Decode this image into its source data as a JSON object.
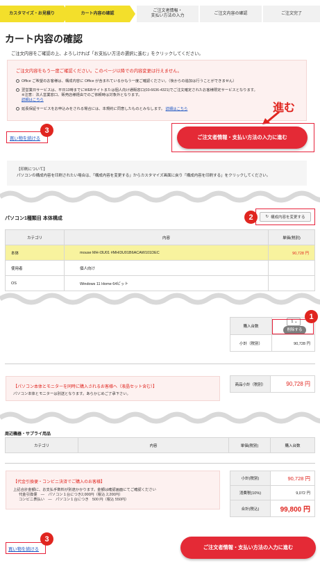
{
  "steps": [
    {
      "label": "カスタマイズ・お見積り",
      "state": "done"
    },
    {
      "label": "カート内容の確認",
      "state": "active"
    },
    {
      "label": "ご注文者情報・\n支払い方法の入力",
      "state": "todo"
    },
    {
      "label": "ご注文内容の確認",
      "state": "todo"
    },
    {
      "label": "ご注文完了",
      "state": "todo"
    }
  ],
  "page_title": "カート内容の確認",
  "intro": "ご注文内容をご確認の上、よろしければ「お支払い方法の選択に進む」をクリックしてください。",
  "notice": {
    "title": "ご注文内容をもう一度ご確認ください。このページ以降での内容変更は行えません。",
    "bullets": [
      "Office ご希望のお客様は、構成内容に Office が含まれているかもう一度ご確認ください。（後からの追加は行うことができません）",
      "翌営業日サービスは、平日13時までにWEBサイトまたは個人向け通販窓口(03-6636-4321)でご注文確定されたお客様限定サービスとなります。",
      "※注意：法人営業窓口、販売店様経由でのご依頼時は対象外となります。",
      "延長保証サービスをお申込みをされる場合には、本規約に同意したものとみなします。"
    ],
    "detail_link": "詳細はこちら"
  },
  "continue_shopping": "買い物を続ける",
  "proceed_button": "ご注文者情報・支払い方法の入力に進む",
  "susumu": "進む",
  "badges": [
    "1",
    "2",
    "3"
  ],
  "print_box": {
    "title": "【印刷について】",
    "text": "パソコンの構成内容を印刷されたい場合は、「構成内容を変更する」からカスタマイズ画面に戻り「構成内容を印刷する」をクリックしてください。"
  },
  "pc_section_title": "パソコン1種類目 本体構成",
  "change_config_button": "構成内容を変更する",
  "spec_table": {
    "headers": [
      "カテゴリ",
      "内容",
      "単価(税別)"
    ],
    "rows": [
      {
        "category": "本体",
        "content": "mouse MH-I3U01 #MHI3U01B6ACAW101DEC",
        "price": "90,728 円"
      },
      {
        "category": "使用者",
        "content": "個人向け",
        "price": ""
      },
      {
        "category": "OS",
        "content": "Windows 11 Home 64ビット",
        "price": ""
      }
    ]
  },
  "qty_table": {
    "qty_label": "購入台数",
    "qty_value": "1",
    "delete_label": "削除する",
    "subtotal_label": "小計（税別）",
    "subtotal_value": "90,728 円"
  },
  "monitor_note": {
    "title": "【パソコン本体とモニターを同時に購入されるお客様へ（液晶セット含む）】",
    "body": "パソコン本体とモニターは別送となります。あらかじめご了承下さい。"
  },
  "product_subtotal": {
    "label": "商品小計（税別）",
    "value": "90,728 円"
  },
  "peripheral_section_title": "周辺機器・サプライ用品",
  "peripheral_headers": [
    "カテゴリ",
    "内容",
    "単価(税別)",
    "購入台数"
  ],
  "cod_note": {
    "title": "【代金引換便・コンビニ決済でご購入のお客様】",
    "lines": [
      "上記合計金額に、お支払手数料が別途かかります。金額は確認画面にてご確認ください",
      "代金引換便　―　パソコン１台につき2,000円（税込 2,200円）",
      "コンビニ表払い　―　パソコン１台につき　500 円（税込 550円）"
    ]
  },
  "totals": {
    "subtotal_label": "小計(税別)",
    "subtotal_value": "90,728 円",
    "tax_label": "消費税(10%)",
    "tax_value": "9,072 円",
    "total_label": "合計(税込)",
    "total_value": "99,800 円"
  },
  "colors": {
    "accent": "#e42a36",
    "step_active": "#f3df2b",
    "link": "#1a54c2"
  }
}
